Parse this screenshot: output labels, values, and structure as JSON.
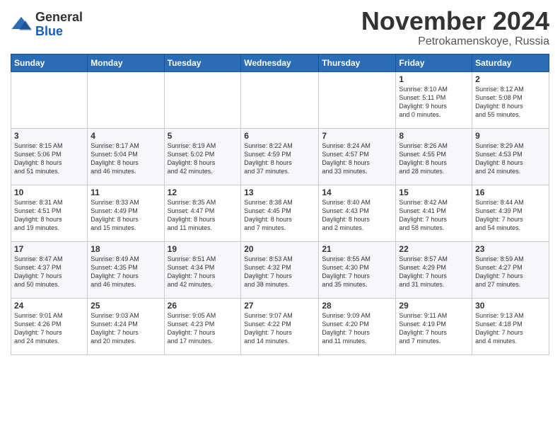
{
  "logo": {
    "general": "General",
    "blue": "Blue"
  },
  "header": {
    "month": "November 2024",
    "location": "Petrokamenskoye, Russia"
  },
  "weekdays": [
    "Sunday",
    "Monday",
    "Tuesday",
    "Wednesday",
    "Thursday",
    "Friday",
    "Saturday"
  ],
  "weeks": [
    [
      {
        "day": "",
        "info": ""
      },
      {
        "day": "",
        "info": ""
      },
      {
        "day": "",
        "info": ""
      },
      {
        "day": "",
        "info": ""
      },
      {
        "day": "",
        "info": ""
      },
      {
        "day": "1",
        "info": "Sunrise: 8:10 AM\nSunset: 5:11 PM\nDaylight: 9 hours\nand 0 minutes."
      },
      {
        "day": "2",
        "info": "Sunrise: 8:12 AM\nSunset: 5:08 PM\nDaylight: 8 hours\nand 55 minutes."
      }
    ],
    [
      {
        "day": "3",
        "info": "Sunrise: 8:15 AM\nSunset: 5:06 PM\nDaylight: 8 hours\nand 51 minutes."
      },
      {
        "day": "4",
        "info": "Sunrise: 8:17 AM\nSunset: 5:04 PM\nDaylight: 8 hours\nand 46 minutes."
      },
      {
        "day": "5",
        "info": "Sunrise: 8:19 AM\nSunset: 5:02 PM\nDaylight: 8 hours\nand 42 minutes."
      },
      {
        "day": "6",
        "info": "Sunrise: 8:22 AM\nSunset: 4:59 PM\nDaylight: 8 hours\nand 37 minutes."
      },
      {
        "day": "7",
        "info": "Sunrise: 8:24 AM\nSunset: 4:57 PM\nDaylight: 8 hours\nand 33 minutes."
      },
      {
        "day": "8",
        "info": "Sunrise: 8:26 AM\nSunset: 4:55 PM\nDaylight: 8 hours\nand 28 minutes."
      },
      {
        "day": "9",
        "info": "Sunrise: 8:29 AM\nSunset: 4:53 PM\nDaylight: 8 hours\nand 24 minutes."
      }
    ],
    [
      {
        "day": "10",
        "info": "Sunrise: 8:31 AM\nSunset: 4:51 PM\nDaylight: 8 hours\nand 19 minutes."
      },
      {
        "day": "11",
        "info": "Sunrise: 8:33 AM\nSunset: 4:49 PM\nDaylight: 8 hours\nand 15 minutes."
      },
      {
        "day": "12",
        "info": "Sunrise: 8:35 AM\nSunset: 4:47 PM\nDaylight: 8 hours\nand 11 minutes."
      },
      {
        "day": "13",
        "info": "Sunrise: 8:38 AM\nSunset: 4:45 PM\nDaylight: 8 hours\nand 7 minutes."
      },
      {
        "day": "14",
        "info": "Sunrise: 8:40 AM\nSunset: 4:43 PM\nDaylight: 8 hours\nand 2 minutes."
      },
      {
        "day": "15",
        "info": "Sunrise: 8:42 AM\nSunset: 4:41 PM\nDaylight: 7 hours\nand 58 minutes."
      },
      {
        "day": "16",
        "info": "Sunrise: 8:44 AM\nSunset: 4:39 PM\nDaylight: 7 hours\nand 54 minutes."
      }
    ],
    [
      {
        "day": "17",
        "info": "Sunrise: 8:47 AM\nSunset: 4:37 PM\nDaylight: 7 hours\nand 50 minutes."
      },
      {
        "day": "18",
        "info": "Sunrise: 8:49 AM\nSunset: 4:35 PM\nDaylight: 7 hours\nand 46 minutes."
      },
      {
        "day": "19",
        "info": "Sunrise: 8:51 AM\nSunset: 4:34 PM\nDaylight: 7 hours\nand 42 minutes."
      },
      {
        "day": "20",
        "info": "Sunrise: 8:53 AM\nSunset: 4:32 PM\nDaylight: 7 hours\nand 38 minutes."
      },
      {
        "day": "21",
        "info": "Sunrise: 8:55 AM\nSunset: 4:30 PM\nDaylight: 7 hours\nand 35 minutes."
      },
      {
        "day": "22",
        "info": "Sunrise: 8:57 AM\nSunset: 4:29 PM\nDaylight: 7 hours\nand 31 minutes."
      },
      {
        "day": "23",
        "info": "Sunrise: 8:59 AM\nSunset: 4:27 PM\nDaylight: 7 hours\nand 27 minutes."
      }
    ],
    [
      {
        "day": "24",
        "info": "Sunrise: 9:01 AM\nSunset: 4:26 PM\nDaylight: 7 hours\nand 24 minutes."
      },
      {
        "day": "25",
        "info": "Sunrise: 9:03 AM\nSunset: 4:24 PM\nDaylight: 7 hours\nand 20 minutes."
      },
      {
        "day": "26",
        "info": "Sunrise: 9:05 AM\nSunset: 4:23 PM\nDaylight: 7 hours\nand 17 minutes."
      },
      {
        "day": "27",
        "info": "Sunrise: 9:07 AM\nSunset: 4:22 PM\nDaylight: 7 hours\nand 14 minutes."
      },
      {
        "day": "28",
        "info": "Sunrise: 9:09 AM\nSunset: 4:20 PM\nDaylight: 7 hours\nand 11 minutes."
      },
      {
        "day": "29",
        "info": "Sunrise: 9:11 AM\nSunset: 4:19 PM\nDaylight: 7 hours\nand 7 minutes."
      },
      {
        "day": "30",
        "info": "Sunrise: 9:13 AM\nSunset: 4:18 PM\nDaylight: 7 hours\nand 4 minutes."
      }
    ]
  ]
}
